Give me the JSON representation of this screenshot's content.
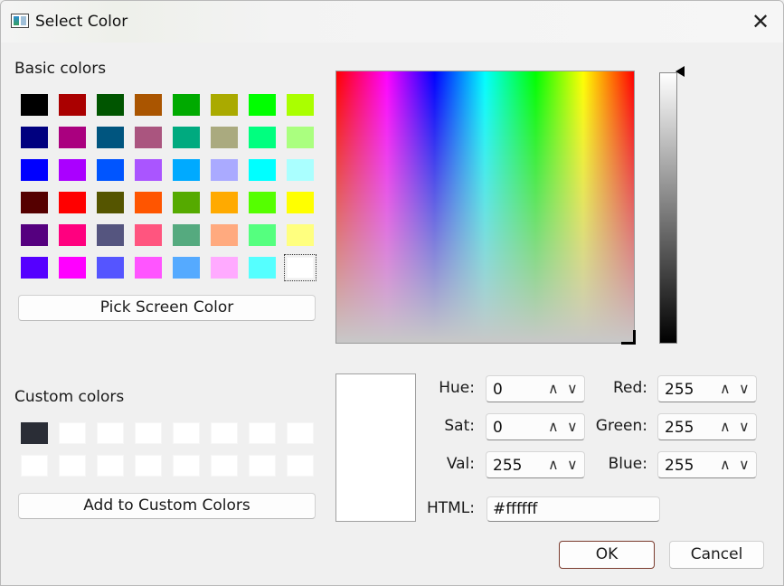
{
  "dialog": {
    "title": "Select Color",
    "close_glyph": "✕"
  },
  "basic_colors": {
    "label": "Basic colors",
    "colors": [
      [
        "#000000",
        "#aa0000",
        "#005500",
        "#aa5500",
        "#00aa00",
        "#aaaa00",
        "#00ff00",
        "#aaff00"
      ],
      [
        "#00007f",
        "#aa007f",
        "#00557f",
        "#aa557f",
        "#00aa7f",
        "#aaaa7f",
        "#00ff7f",
        "#aaff7f"
      ],
      [
        "#0000ff",
        "#aa00ff",
        "#0055ff",
        "#aa55ff",
        "#00aaff",
        "#aaaaff",
        "#00ffff",
        "#aaffff"
      ],
      [
        "#550000",
        "#ff0000",
        "#555500",
        "#ff5500",
        "#55aa00",
        "#ffaa00",
        "#55ff00",
        "#ffff00"
      ],
      [
        "#55007f",
        "#ff007f",
        "#55557f",
        "#ff557f",
        "#55aa7f",
        "#ffaa7f",
        "#55ff7f",
        "#ffff7f"
      ],
      [
        "#5500ff",
        "#ff00ff",
        "#5555ff",
        "#ff55ff",
        "#55aaff",
        "#ffaaff",
        "#55ffff",
        "#ffffff"
      ]
    ],
    "selected": "#ffffff"
  },
  "pick_screen_button": "Pick Screen Color",
  "custom_colors": {
    "label": "Custom colors",
    "colors": [
      [
        "#2a2d36",
        "#ffffff",
        "#ffffff",
        "#ffffff",
        "#ffffff",
        "#ffffff",
        "#ffffff",
        "#ffffff"
      ],
      [
        "#ffffff",
        "#ffffff",
        "#ffffff",
        "#ffffff",
        "#ffffff",
        "#ffffff",
        "#ffffff",
        "#ffffff"
      ]
    ]
  },
  "add_custom_button": "Add to Custom Colors",
  "fields": {
    "hue": {
      "label": "Hue:",
      "value": "0"
    },
    "sat": {
      "label": "Sat:",
      "value": "0"
    },
    "val": {
      "label": "Val:",
      "value": "255"
    },
    "red": {
      "label": "Red:",
      "value": "255"
    },
    "green": {
      "label": "Green:",
      "value": "255"
    },
    "blue": {
      "label": "Blue:",
      "value": "255"
    },
    "html": {
      "label": "HTML:",
      "value": "#ffffff"
    }
  },
  "spin_up_glyph": "∧",
  "spin_down_glyph": "∨",
  "current_color": "#ffffff",
  "ok_button": "OK",
  "cancel_button": "Cancel"
}
